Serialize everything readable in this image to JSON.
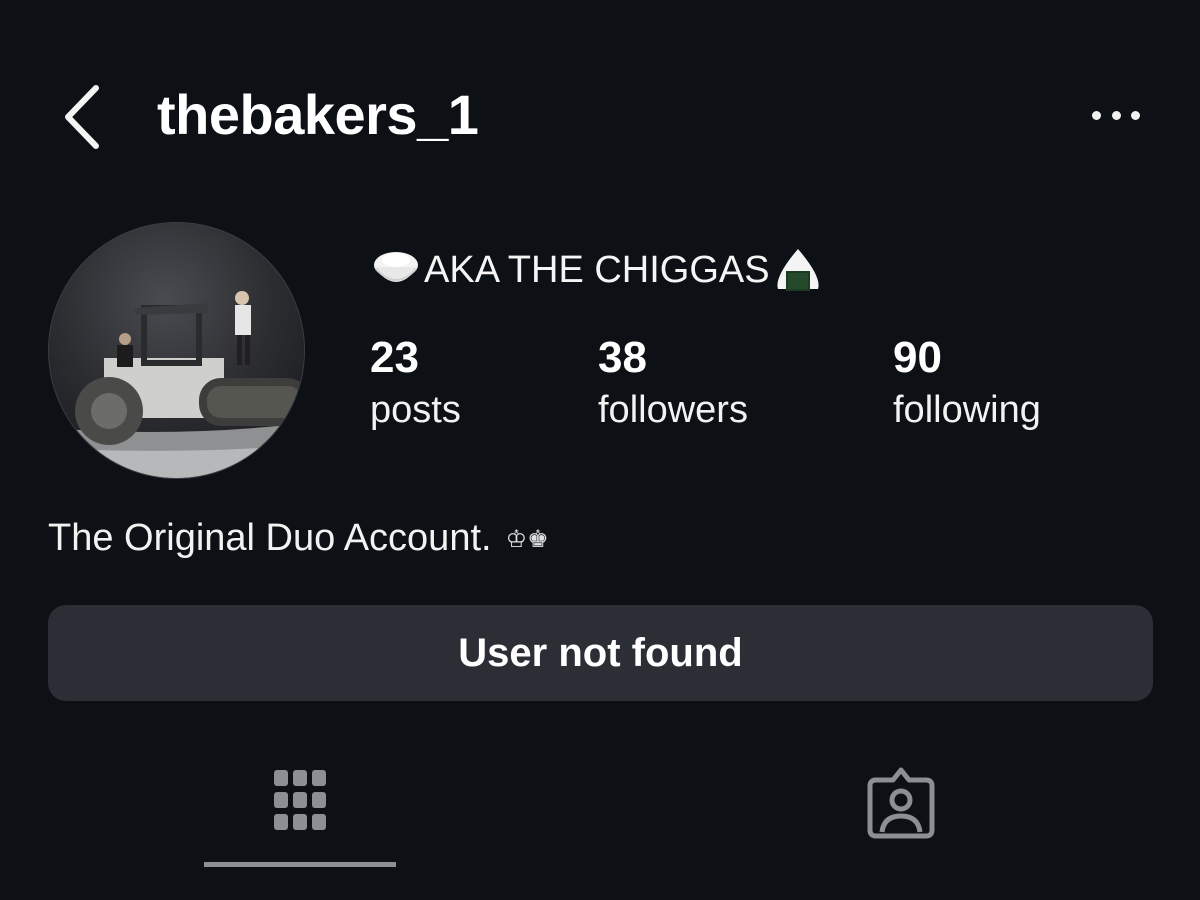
{
  "header": {
    "username": "thebakers_1",
    "back_icon": "chevron-left-icon",
    "more_icon": "ellipsis-icon"
  },
  "profile": {
    "display_name": "AKA THE CHIGGAS",
    "display_name_emoji_left": "rice-bowl-emoji",
    "display_name_emoji_right": "rice-ball-emoji",
    "bio": "The Original Duo Account.",
    "bio_symbols": "♔♚"
  },
  "stats": {
    "posts": {
      "count": "23",
      "label": "posts"
    },
    "followers": {
      "count": "38",
      "label": "followers"
    },
    "following": {
      "count": "90",
      "label": "following"
    }
  },
  "action_button": {
    "label": "User not found"
  },
  "tabs": [
    {
      "name": "posts-grid",
      "icon": "grid-icon",
      "active": true
    },
    {
      "name": "tagged",
      "icon": "tagged-person-icon",
      "active": false
    }
  ],
  "colors": {
    "background": "#0d1115",
    "button_bg": "#2b2f35",
    "text": "#f5f5f5",
    "muted_icon": "#8c8f94"
  }
}
